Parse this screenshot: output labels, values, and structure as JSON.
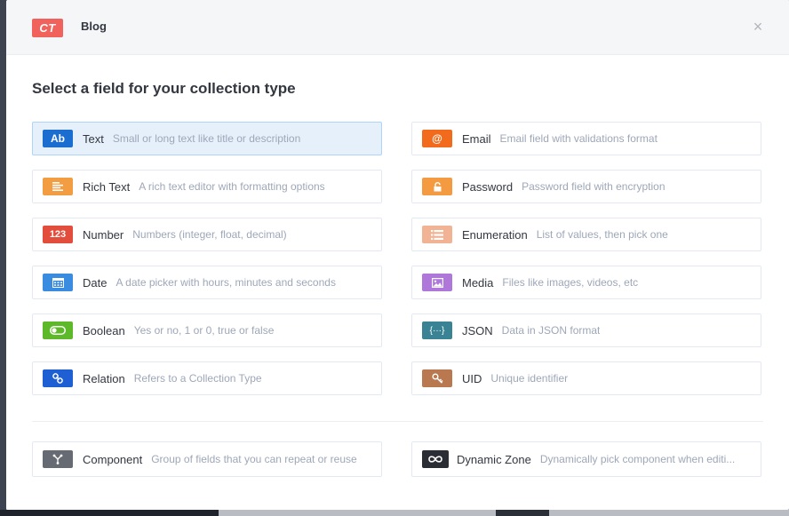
{
  "header": {
    "badge": "CT",
    "title": "Blog",
    "close_glyph": "×"
  },
  "section_title": "Select a field for your collection type",
  "left_fields": [
    {
      "name": "Text",
      "desc": "Small or long text like title or description",
      "icon_label": "Ab",
      "icon": "text-icon",
      "color": "#1c6dd0",
      "active": true
    },
    {
      "name": "Rich Text",
      "desc": "A rich text editor with formatting options",
      "icon_label": "",
      "icon": "richtext-icon",
      "color": "#f29d41"
    },
    {
      "name": "Number",
      "desc": "Numbers (integer, float, decimal)",
      "icon_label": "123",
      "icon": "number-icon",
      "color": "#e24d3c"
    },
    {
      "name": "Date",
      "desc": "A date picker with hours, minutes and seconds",
      "icon_label": "",
      "icon": "calendar-icon",
      "color": "#3a8ce0"
    },
    {
      "name": "Boolean",
      "desc": "Yes or no, 1 or 0, true or false",
      "icon_label": "",
      "icon": "toggle-icon",
      "color": "#5db82a"
    },
    {
      "name": "Relation",
      "desc": "Refers to a Collection Type",
      "icon_label": "",
      "icon": "link-icon",
      "color": "#1f5fd4"
    }
  ],
  "right_fields": [
    {
      "name": "Email",
      "desc": "Email field with validations format",
      "icon_label": "@",
      "icon": "at-icon",
      "color": "#f26a1b"
    },
    {
      "name": "Password",
      "desc": "Password field with encryption",
      "icon_label": "",
      "icon": "lock-icon",
      "color": "#f49b42"
    },
    {
      "name": "Enumeration",
      "desc": "List of values, then pick one",
      "icon_label": "",
      "icon": "list-icon",
      "color": "#f1b393"
    },
    {
      "name": "Media",
      "desc": "Files like images, videos, etc",
      "icon_label": "",
      "icon": "image-icon",
      "color": "#b077da"
    },
    {
      "name": "JSON",
      "desc": "Data in JSON format",
      "icon_label": "{···}",
      "icon": "json-icon",
      "color": "#3a8394"
    },
    {
      "name": "UID",
      "desc": "Unique identifier",
      "icon_label": "",
      "icon": "key-icon",
      "color": "#b9784f"
    }
  ],
  "bottom_fields": [
    {
      "name": "Component",
      "desc": "Group of fields that you can repeat or reuse",
      "icon": "component-icon",
      "color": "#666a72"
    },
    {
      "name": "Dynamic Zone",
      "desc": "Dynamically pick component when editi...",
      "icon": "infinity-icon",
      "color": "#2a2d33"
    }
  ]
}
